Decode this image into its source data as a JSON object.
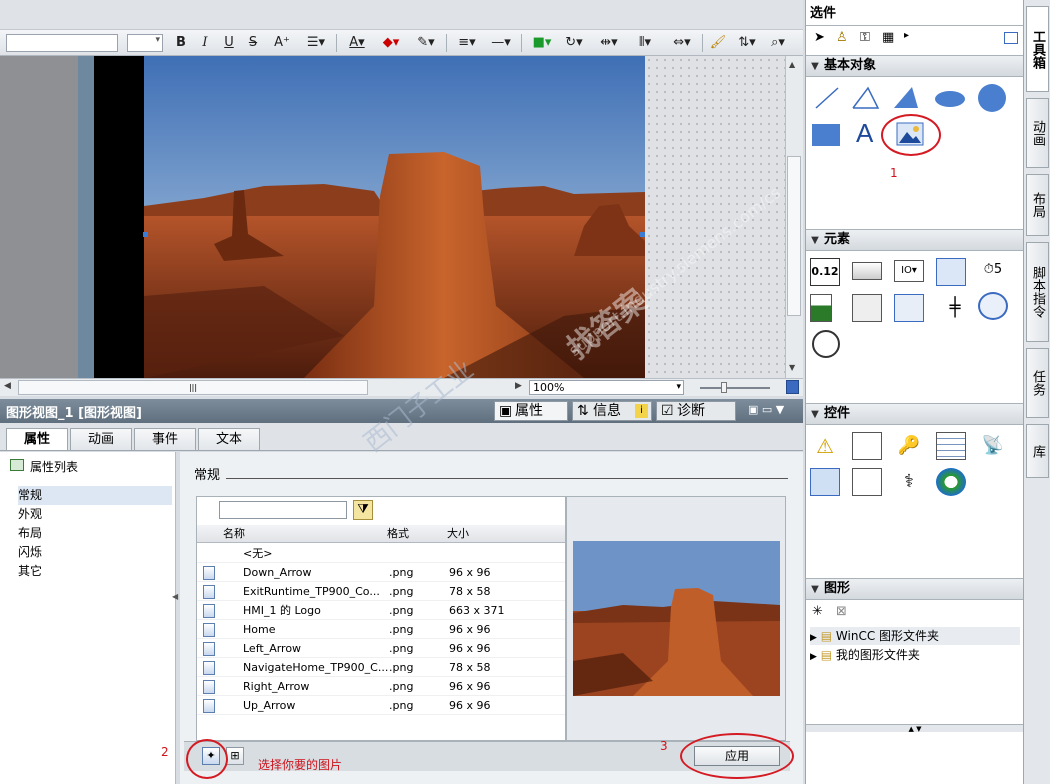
{
  "toolbar": {
    "bold": "B",
    "italic": "I",
    "underline": "U",
    "strike": "S"
  },
  "canvas": {
    "zoom": "100%"
  },
  "inspector": {
    "title": "图形视图_1 [图形视图]",
    "tabs_right": [
      "属性",
      "信息",
      "诊断"
    ],
    "tabs": [
      "属性",
      "动画",
      "事件",
      "文本"
    ],
    "property_list_label": "属性列表",
    "nav_items": [
      "常规",
      "外观",
      "布局",
      "闪烁",
      "其它"
    ],
    "section_title": "常规",
    "filter_placeholder": "",
    "columns": [
      "名称",
      "格式",
      "大小"
    ],
    "rows": [
      {
        "name": "<无>",
        "format": "",
        "size": ""
      },
      {
        "name": "Down_Arrow",
        "format": ".png",
        "size": "96 x 96"
      },
      {
        "name": "ExitRuntime_TP900_Co...",
        "format": ".png",
        "size": "78 x 58"
      },
      {
        "name": "HMI_1 的 Logo",
        "format": ".png",
        "size": "663 x 371"
      },
      {
        "name": "Home",
        "format": ".png",
        "size": "96 x 96"
      },
      {
        "name": "Left_Arrow",
        "format": ".png",
        "size": "96 x 96"
      },
      {
        "name": "NavigateHome_TP900_C...",
        "format": ".png",
        "size": "78 x 58"
      },
      {
        "name": "Right_Arrow",
        "format": ".png",
        "size": "96 x 96"
      },
      {
        "name": "Up_Arrow",
        "format": ".png",
        "size": "96 x 96"
      }
    ],
    "apply_label": "应用",
    "annotation_text": "选择你要的图片",
    "marker_1": "1",
    "marker_2": "2",
    "marker_3": "3"
  },
  "right_panel": {
    "options_title": "选件",
    "basic_objects_title": "基本对象",
    "elements_title": "元素",
    "controls_title": "控件",
    "graphics_title": "图形",
    "graphics_tree": [
      "WinCC 图形文件夹",
      "我的图形文件夹"
    ],
    "text_tool": "A"
  },
  "vertical_tabs": [
    "工具箱",
    "动画",
    "布局",
    "脚本指令",
    "任务",
    "库"
  ],
  "watermark": {
    "line1": "找答案",
    "line2": "support.industry.siemens.com/cs",
    "line3": "西门子工业"
  }
}
